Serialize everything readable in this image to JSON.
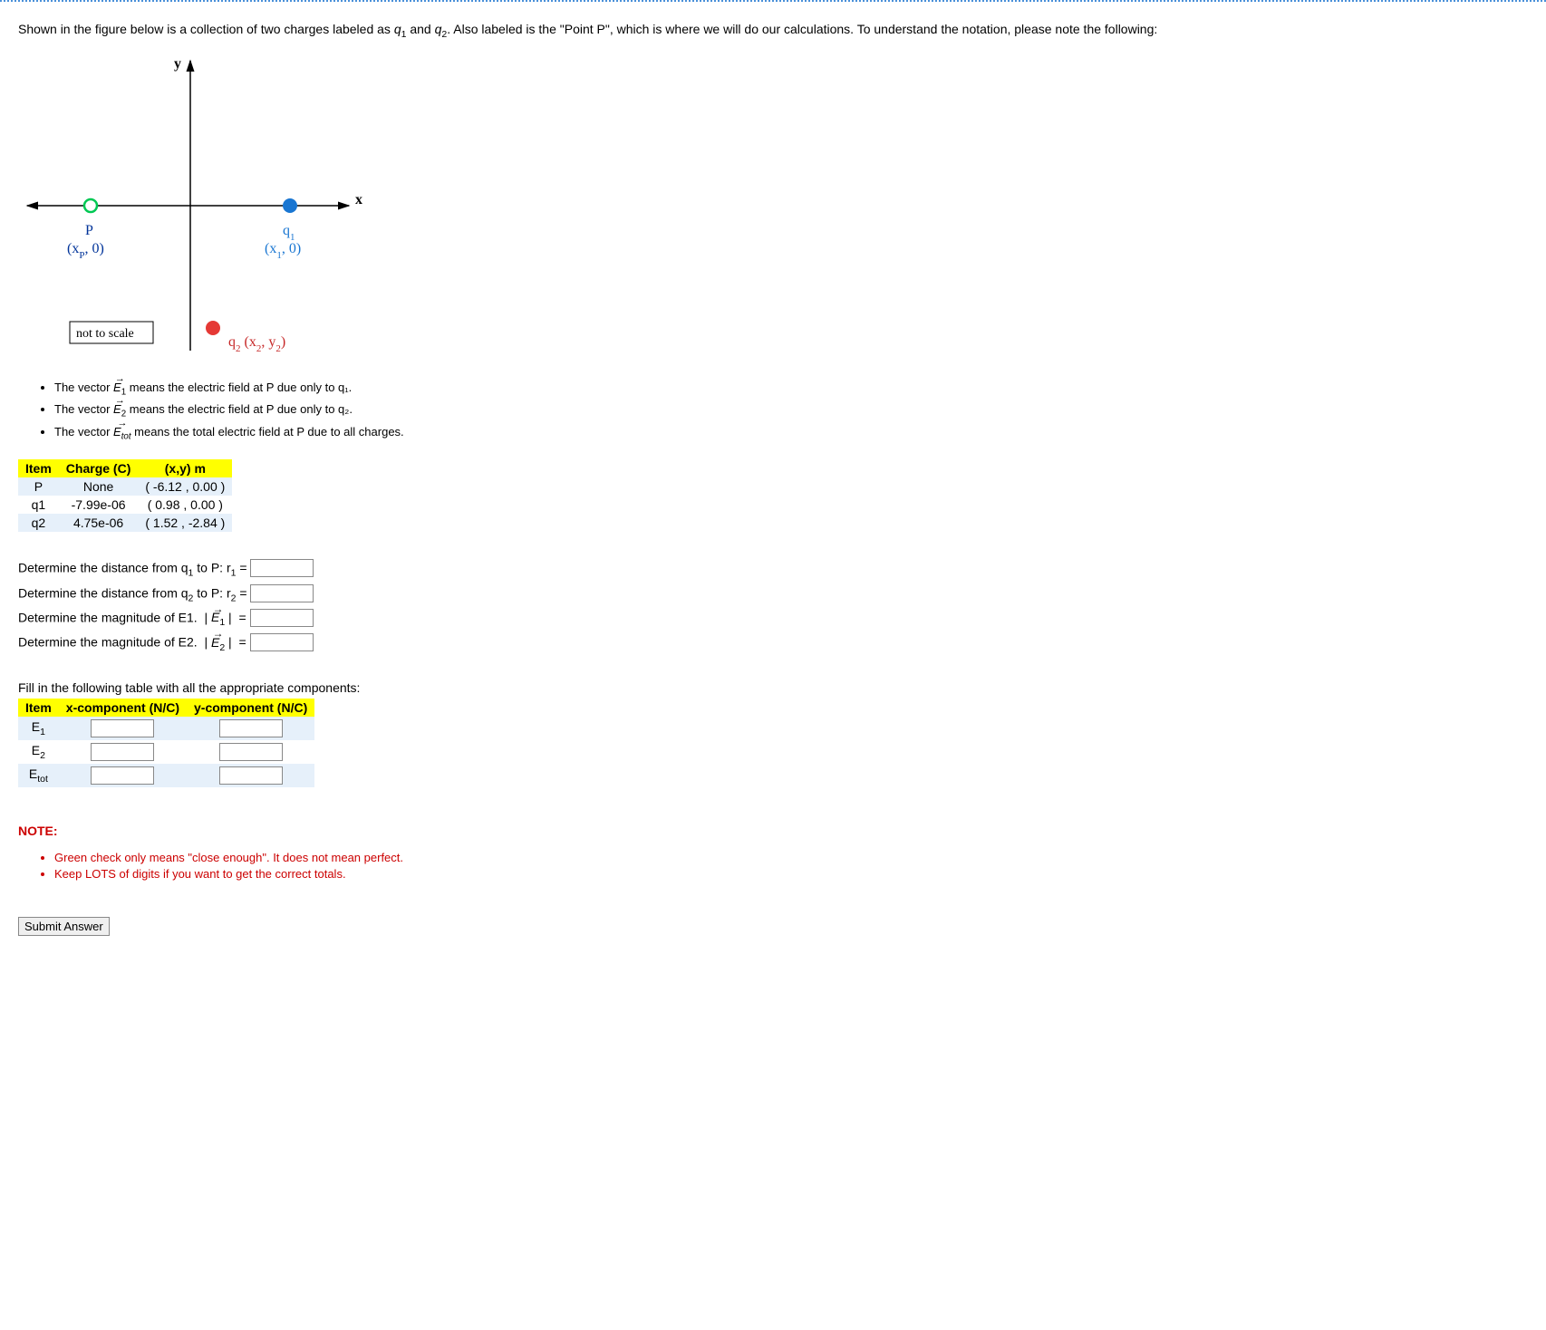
{
  "intro": "Shown in the figure below is a collection of two charges labeled as q₁ and q₂. Also labeled is the \"Point P\", which is where we will do our calculations. To understand the notation, please note the following:",
  "diagram": {
    "y_label": "y",
    "x_label": "x",
    "p_label": "P",
    "p_coord": "(xₚ, 0)",
    "q1_label": "q₁",
    "q1_coord": "(x₁, 0)",
    "q2_label": "q₂  (x₂, y₂)",
    "not_to_scale": "not to scale"
  },
  "bullets": {
    "b1_pre": "The vector ",
    "b1_vec": "E₁",
    "b1_post": " means the electric field at P due only to q₁.",
    "b2_pre": "The vector ",
    "b2_vec": "E₂",
    "b2_post": " means the electric field at P due only to q₂.",
    "b3_pre": "The vector ",
    "b3_vec": "Eₜₒₜ",
    "b3_post": " means the total electric field at P due to all charges."
  },
  "charge_table": {
    "headers": {
      "item": "Item",
      "charge": "Charge (C)",
      "xy": "(x,y) m"
    },
    "rows": [
      {
        "item": "P",
        "charge": "None",
        "xy": "( -6.12 , 0.00 )"
      },
      {
        "item": "q1",
        "charge": "-7.99e-06",
        "xy": "( 0.98 , 0.00 )"
      },
      {
        "item": "q2",
        "charge": "4.75e-06",
        "xy": "( 1.52 , -2.84 )"
      }
    ]
  },
  "questions": {
    "q1": "Determine the distance from q₁ to P: r₁ =",
    "q2": "Determine the distance from q₂ to P: r₂ =",
    "q3": "Determine the magnitude of E1.  | E⃗₁ |  =",
    "q4": "Determine the magnitude of E2.  | E⃗₂ |  ="
  },
  "table_prompt": "Fill in the following table with all the appropriate components:",
  "comp_table": {
    "headers": {
      "item": "Item",
      "xc": "x-component (N/C)",
      "yc": "y-component (N/C)"
    },
    "rows": [
      {
        "item": "E₁"
      },
      {
        "item": "E₂"
      },
      {
        "item": "Eₜₒₜ"
      }
    ]
  },
  "note_header": "NOTE:",
  "notes": {
    "n1": "Green check only means \"close enough\". It does not mean perfect.",
    "n2": "Keep LOTS of digits if you want to get the correct totals."
  },
  "submit": "Submit Answer"
}
